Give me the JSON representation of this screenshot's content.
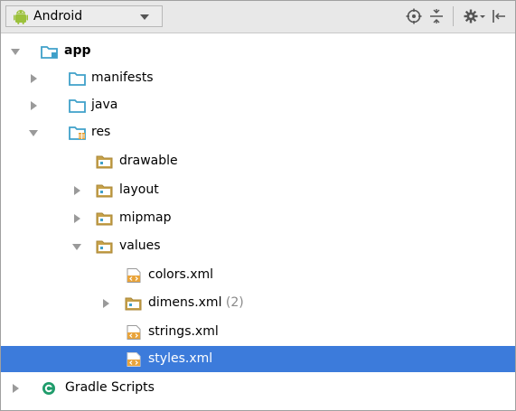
{
  "toolbar": {
    "view_label": "Android",
    "icons": [
      "android-icon",
      "chevron-down-icon",
      "target-icon",
      "collapse-icon",
      "gear-icon",
      "hide-icon"
    ]
  },
  "tree": {
    "app": "app",
    "manifests": "manifests",
    "java": "java",
    "res": "res",
    "drawable": "drawable",
    "layout": "layout",
    "mipmap": "mipmap",
    "values": "values",
    "colors": "colors.xml",
    "dimens": "dimens.xml",
    "dimens_count": "(2)",
    "strings": "strings.xml",
    "styles": "styles.xml",
    "gradle": "Gradle Scripts"
  },
  "colors": {
    "selection": "#3c7bdb",
    "folder": "#3fa0c9",
    "android_green": "#9bc13b",
    "xml_orange": "#e9a43b",
    "gradle_green": "#1f9c6b"
  }
}
